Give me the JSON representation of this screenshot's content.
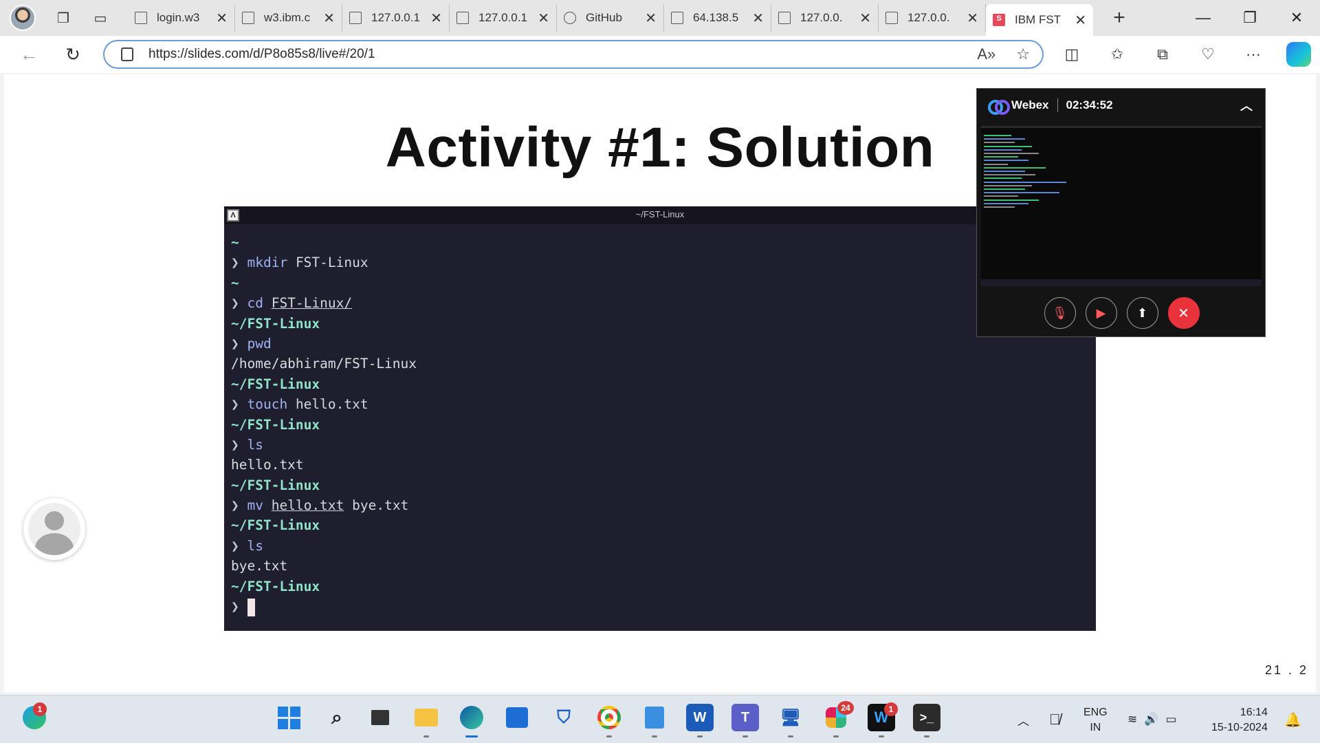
{
  "browser": {
    "tabs": [
      {
        "title": "login.w3",
        "favicon": "globe-icon"
      },
      {
        "title": "w3.ibm.c",
        "favicon": "page-icon"
      },
      {
        "title": "127.0.0.1",
        "favicon": "page-icon"
      },
      {
        "title": "127.0.0.1",
        "favicon": "page-icon"
      },
      {
        "title": "GitHub",
        "favicon": "github-icon"
      },
      {
        "title": "64.138.5",
        "favicon": "page-icon"
      },
      {
        "title": "127.0.0.",
        "favicon": "page-icon"
      },
      {
        "title": "127.0.0.",
        "favicon": "page-icon"
      },
      {
        "title": "IBM FST",
        "favicon": "slides-icon",
        "favicon_letter": "S",
        "active": true
      }
    ],
    "url": "https://slides.com/d/P8o85s8/live#/20/1"
  },
  "slide": {
    "title": "Activity #1: Solution",
    "page_number": "21 . 2",
    "terminal": {
      "window_title": "~/FST-Linux",
      "lines": [
        {
          "dir": "~"
        },
        {
          "prompt": "❯",
          "cmd": "mkdir",
          "args": " FST-Linux"
        },
        {
          "dir": "~"
        },
        {
          "prompt": "❯",
          "cmd": "cd",
          "args": " ",
          "ul": "FST-Linux/"
        },
        {
          "dir": "~/FST-Linux"
        },
        {
          "prompt": "❯",
          "cmd": "pwd",
          "args": ""
        },
        {
          "out": "/home/abhiram/FST-Linux"
        },
        {
          "dir": "~/FST-Linux"
        },
        {
          "prompt": "❯",
          "cmd": "touch",
          "args": " hello.txt"
        },
        {
          "dir": "~/FST-Linux"
        },
        {
          "prompt": "❯",
          "cmd": "ls",
          "args": ""
        },
        {
          "out": "hello.txt"
        },
        {
          "dir": "~/FST-Linux"
        },
        {
          "prompt": "❯",
          "cmd": "mv",
          "args": " ",
          "ul": "hello.txt",
          "tail": " bye.txt"
        },
        {
          "dir": "~/FST-Linux"
        },
        {
          "prompt": "❯",
          "cmd": "ls",
          "args": ""
        },
        {
          "out": "bye.txt"
        },
        {
          "dir": "~/FST-Linux"
        },
        {
          "prompt": "❯",
          "cursor": true
        }
      ]
    }
  },
  "webex": {
    "app_name": "Webex",
    "timer": "02:34:52"
  },
  "taskbar": {
    "language": "ENG",
    "region": "IN",
    "time": "16:14",
    "date": "15-10-2024",
    "badges": {
      "widgets": "1",
      "slack": "24",
      "webex": "1"
    }
  },
  "colors": {
    "accent": "#1a6fd6",
    "terminal_bg": "#1f1e2e",
    "end_call": "#e8323c"
  }
}
